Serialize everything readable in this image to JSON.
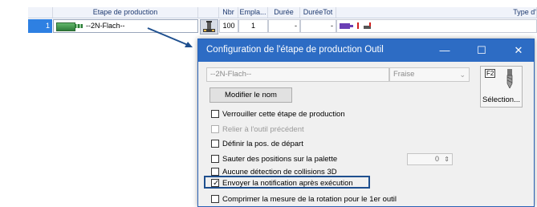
{
  "grid": {
    "headers": {
      "step": "Etape de production",
      "nbr": "Nbr",
      "empla": "Empla...",
      "duree": "Durée",
      "dureetot": "DuréeTot",
      "type": "Type d'"
    },
    "row": {
      "number": "1",
      "step_name": "--2N-Flach--",
      "nbr": "100",
      "empla": "1",
      "duree": "-",
      "dureetot": "-"
    }
  },
  "dialog": {
    "title": "Configuration de l'étape de production Outil",
    "name_value": "--2N-Flach--",
    "type_value": "Fraise",
    "rename_label": "Modifier le nom",
    "selection_label": "Sélection...",
    "f2_label": "F2",
    "spin_value": "0",
    "options": [
      {
        "label": "Verrouiller cette étape de production",
        "checked": false,
        "enabled": true
      },
      {
        "label": "Relier à l'outil précédent",
        "checked": false,
        "enabled": false
      },
      {
        "label": "Définir la pos. de départ",
        "checked": false,
        "enabled": true
      },
      {
        "label": "Sauter des positions sur la palette",
        "checked": false,
        "enabled": true
      },
      {
        "label": "Aucune détection de collisions 3D",
        "checked": false,
        "enabled": true
      },
      {
        "label": "Envoyer la notification après exécution",
        "checked": true,
        "enabled": true
      },
      {
        "label": "Comprimer la mesure de la rotation pour le 1er outil",
        "checked": false,
        "enabled": true
      }
    ]
  },
  "colors": {
    "titlebar": "#2d6cc4",
    "selected_row": "#2e80e2",
    "highlight_border": "#1e4f8e",
    "tool_green": "#2f7c3a"
  },
  "icons": [
    "machine-icon",
    "tool-icon",
    "min-icon",
    "max-icon",
    "close-icon",
    "drill-icon",
    "dropdown-icon",
    "spinner-icon",
    "checkmark-icon"
  ]
}
